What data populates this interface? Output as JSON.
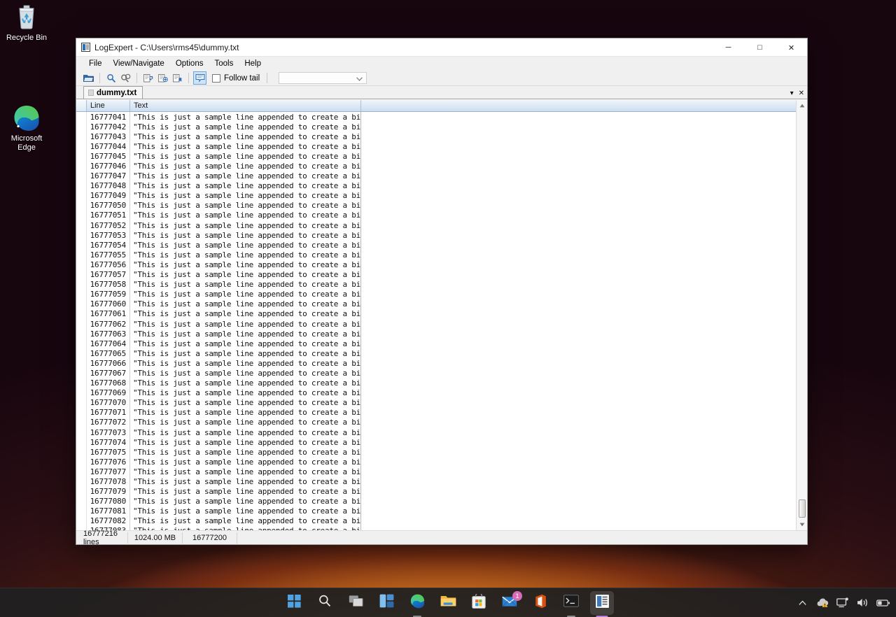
{
  "desktop": {
    "icons": [
      {
        "name": "recycle-bin",
        "label": "Recycle Bin"
      },
      {
        "name": "microsoft-edge",
        "label": "Microsoft\nEdge",
        "label_line1": "Microsoft",
        "label_line2": "Edge"
      }
    ]
  },
  "window": {
    "title": "LogExpert - C:\\Users\\rms45\\dummy.txt",
    "app_icon": "logexpert-icon",
    "controls": {
      "minimize": "─",
      "maximize": "□",
      "close": "✕"
    },
    "menu": [
      {
        "name": "file",
        "label": "File"
      },
      {
        "name": "view-navigate",
        "label": "View/Navigate"
      },
      {
        "name": "options",
        "label": "Options"
      },
      {
        "name": "tools",
        "label": "Tools"
      },
      {
        "name": "help",
        "label": "Help"
      }
    ],
    "toolbar": {
      "buttons": [
        {
          "name": "open-file-icon",
          "title": "Open file"
        },
        {
          "name": "search-icon",
          "title": "Search"
        },
        {
          "name": "search-again-icon",
          "title": "Search again"
        },
        {
          "name": "bookmark-add-icon",
          "title": "Add bookmark"
        },
        {
          "name": "bookmark-remove-icon",
          "title": "Remove bookmark"
        },
        {
          "name": "bookmark-list-icon",
          "title": "Bookmark list"
        },
        {
          "name": "tail-window-icon",
          "title": "Tail window",
          "pressed": true
        }
      ],
      "follow_tail_label": "Follow tail",
      "follow_tail_checked": false,
      "combo_value": "",
      "combo_placeholder": ""
    },
    "tab": {
      "label": "dummy.txt",
      "dropdown_icon": "▾",
      "close_icon": "✕"
    },
    "grid": {
      "columns": [
        {
          "name": "line",
          "label": "Line"
        },
        {
          "name": "text",
          "label": "Text"
        }
      ],
      "rows": [
        {
          "line": "16777041",
          "text": "\"This is just a sample line appended to create a big file.. \""
        },
        {
          "line": "16777042",
          "text": "\"This is just a sample line appended to create a big file.. \""
        },
        {
          "line": "16777043",
          "text": "\"This is just a sample line appended to create a big file.. \""
        },
        {
          "line": "16777044",
          "text": "\"This is just a sample line appended to create a big file.. \""
        },
        {
          "line": "16777045",
          "text": "\"This is just a sample line appended to create a big file.. \""
        },
        {
          "line": "16777046",
          "text": "\"This is just a sample line appended to create a big file.. \""
        },
        {
          "line": "16777047",
          "text": "\"This is just a sample line appended to create a big file.. \""
        },
        {
          "line": "16777048",
          "text": "\"This is just a sample line appended to create a big file.. \""
        },
        {
          "line": "16777049",
          "text": "\"This is just a sample line appended to create a big file.. \""
        },
        {
          "line": "16777050",
          "text": "\"This is just a sample line appended to create a big file.. \""
        },
        {
          "line": "16777051",
          "text": "\"This is just a sample line appended to create a big file.. \""
        },
        {
          "line": "16777052",
          "text": "\"This is just a sample line appended to create a big file.. \""
        },
        {
          "line": "16777053",
          "text": "\"This is just a sample line appended to create a big file.. \""
        },
        {
          "line": "16777054",
          "text": "\"This is just a sample line appended to create a big file.. \""
        },
        {
          "line": "16777055",
          "text": "\"This is just a sample line appended to create a big file.. \""
        },
        {
          "line": "16777056",
          "text": "\"This is just a sample line appended to create a big file.. \""
        },
        {
          "line": "16777057",
          "text": "\"This is just a sample line appended to create a big file.. \""
        },
        {
          "line": "16777058",
          "text": "\"This is just a sample line appended to create a big file.. \""
        },
        {
          "line": "16777059",
          "text": "\"This is just a sample line appended to create a big file.. \""
        },
        {
          "line": "16777060",
          "text": "\"This is just a sample line appended to create a big file.. \""
        },
        {
          "line": "16777061",
          "text": "\"This is just a sample line appended to create a big file.. \""
        },
        {
          "line": "16777062",
          "text": "\"This is just a sample line appended to create a big file.. \""
        },
        {
          "line": "16777063",
          "text": "\"This is just a sample line appended to create a big file.. \""
        },
        {
          "line": "16777064",
          "text": "\"This is just a sample line appended to create a big file.. \""
        },
        {
          "line": "16777065",
          "text": "\"This is just a sample line appended to create a big file.. \""
        },
        {
          "line": "16777066",
          "text": "\"This is just a sample line appended to create a big file.. \""
        },
        {
          "line": "16777067",
          "text": "\"This is just a sample line appended to create a big file.. \""
        },
        {
          "line": "16777068",
          "text": "\"This is just a sample line appended to create a big file.. \""
        },
        {
          "line": "16777069",
          "text": "\"This is just a sample line appended to create a big file.. \""
        },
        {
          "line": "16777070",
          "text": "\"This is just a sample line appended to create a big file.. \""
        },
        {
          "line": "16777071",
          "text": "\"This is just a sample line appended to create a big file.. \""
        },
        {
          "line": "16777072",
          "text": "\"This is just a sample line appended to create a big file.. \""
        },
        {
          "line": "16777073",
          "text": "\"This is just a sample line appended to create a big file.. \""
        },
        {
          "line": "16777074",
          "text": "\"This is just a sample line appended to create a big file.. \""
        },
        {
          "line": "16777075",
          "text": "\"This is just a sample line appended to create a big file.. \""
        },
        {
          "line": "16777076",
          "text": "\"This is just a sample line appended to create a big file.. \""
        },
        {
          "line": "16777077",
          "text": "\"This is just a sample line appended to create a big file.. \""
        },
        {
          "line": "16777078",
          "text": "\"This is just a sample line appended to create a big file.. \""
        },
        {
          "line": "16777079",
          "text": "\"This is just a sample line appended to create a big file.. \""
        },
        {
          "line": "16777080",
          "text": "\"This is just a sample line appended to create a big file.. \""
        },
        {
          "line": "16777081",
          "text": "\"This is just a sample line appended to create a big file.. \""
        },
        {
          "line": "16777082",
          "text": "\"This is just a sample line appended to create a big file.. \""
        },
        {
          "line": "16777083",
          "text": "\"This is just a sample line appended to create a big file.. \""
        }
      ]
    },
    "statusbar": {
      "lines": "16777216 lines",
      "size": "1024.00 MB",
      "position": "16777200"
    }
  },
  "taskbar": {
    "items": [
      {
        "name": "start-button",
        "icon": "windows-logo-icon"
      },
      {
        "name": "search-button",
        "icon": "search-icon"
      },
      {
        "name": "task-view-button",
        "icon": "task-view-icon"
      },
      {
        "name": "widgets-button",
        "icon": "widgets-icon"
      },
      {
        "name": "edge-button",
        "icon": "edge-icon",
        "running": true
      },
      {
        "name": "file-explorer-button",
        "icon": "folder-icon"
      },
      {
        "name": "store-button",
        "icon": "store-icon"
      },
      {
        "name": "mail-button",
        "icon": "mail-icon",
        "badge": "1"
      },
      {
        "name": "office-button",
        "icon": "office-icon"
      },
      {
        "name": "terminal-button",
        "icon": "terminal-icon",
        "running": true
      },
      {
        "name": "logexpert-button",
        "icon": "logexpert-icon",
        "active": true
      }
    ],
    "tray": [
      {
        "name": "show-hidden-icons",
        "icon": "chevron-up-icon"
      },
      {
        "name": "onedrive-warning",
        "icon": "cloud-warning-icon"
      },
      {
        "name": "network",
        "icon": "network-icon"
      },
      {
        "name": "volume",
        "icon": "speaker-icon"
      },
      {
        "name": "battery",
        "icon": "battery-icon"
      }
    ]
  },
  "colors": {
    "accent_blue": "#0078d4",
    "header_blue": "#cddef0",
    "close_red": "#e81123",
    "badge_pink": "#d66bb6",
    "taskbar_bg": "#202020"
  }
}
